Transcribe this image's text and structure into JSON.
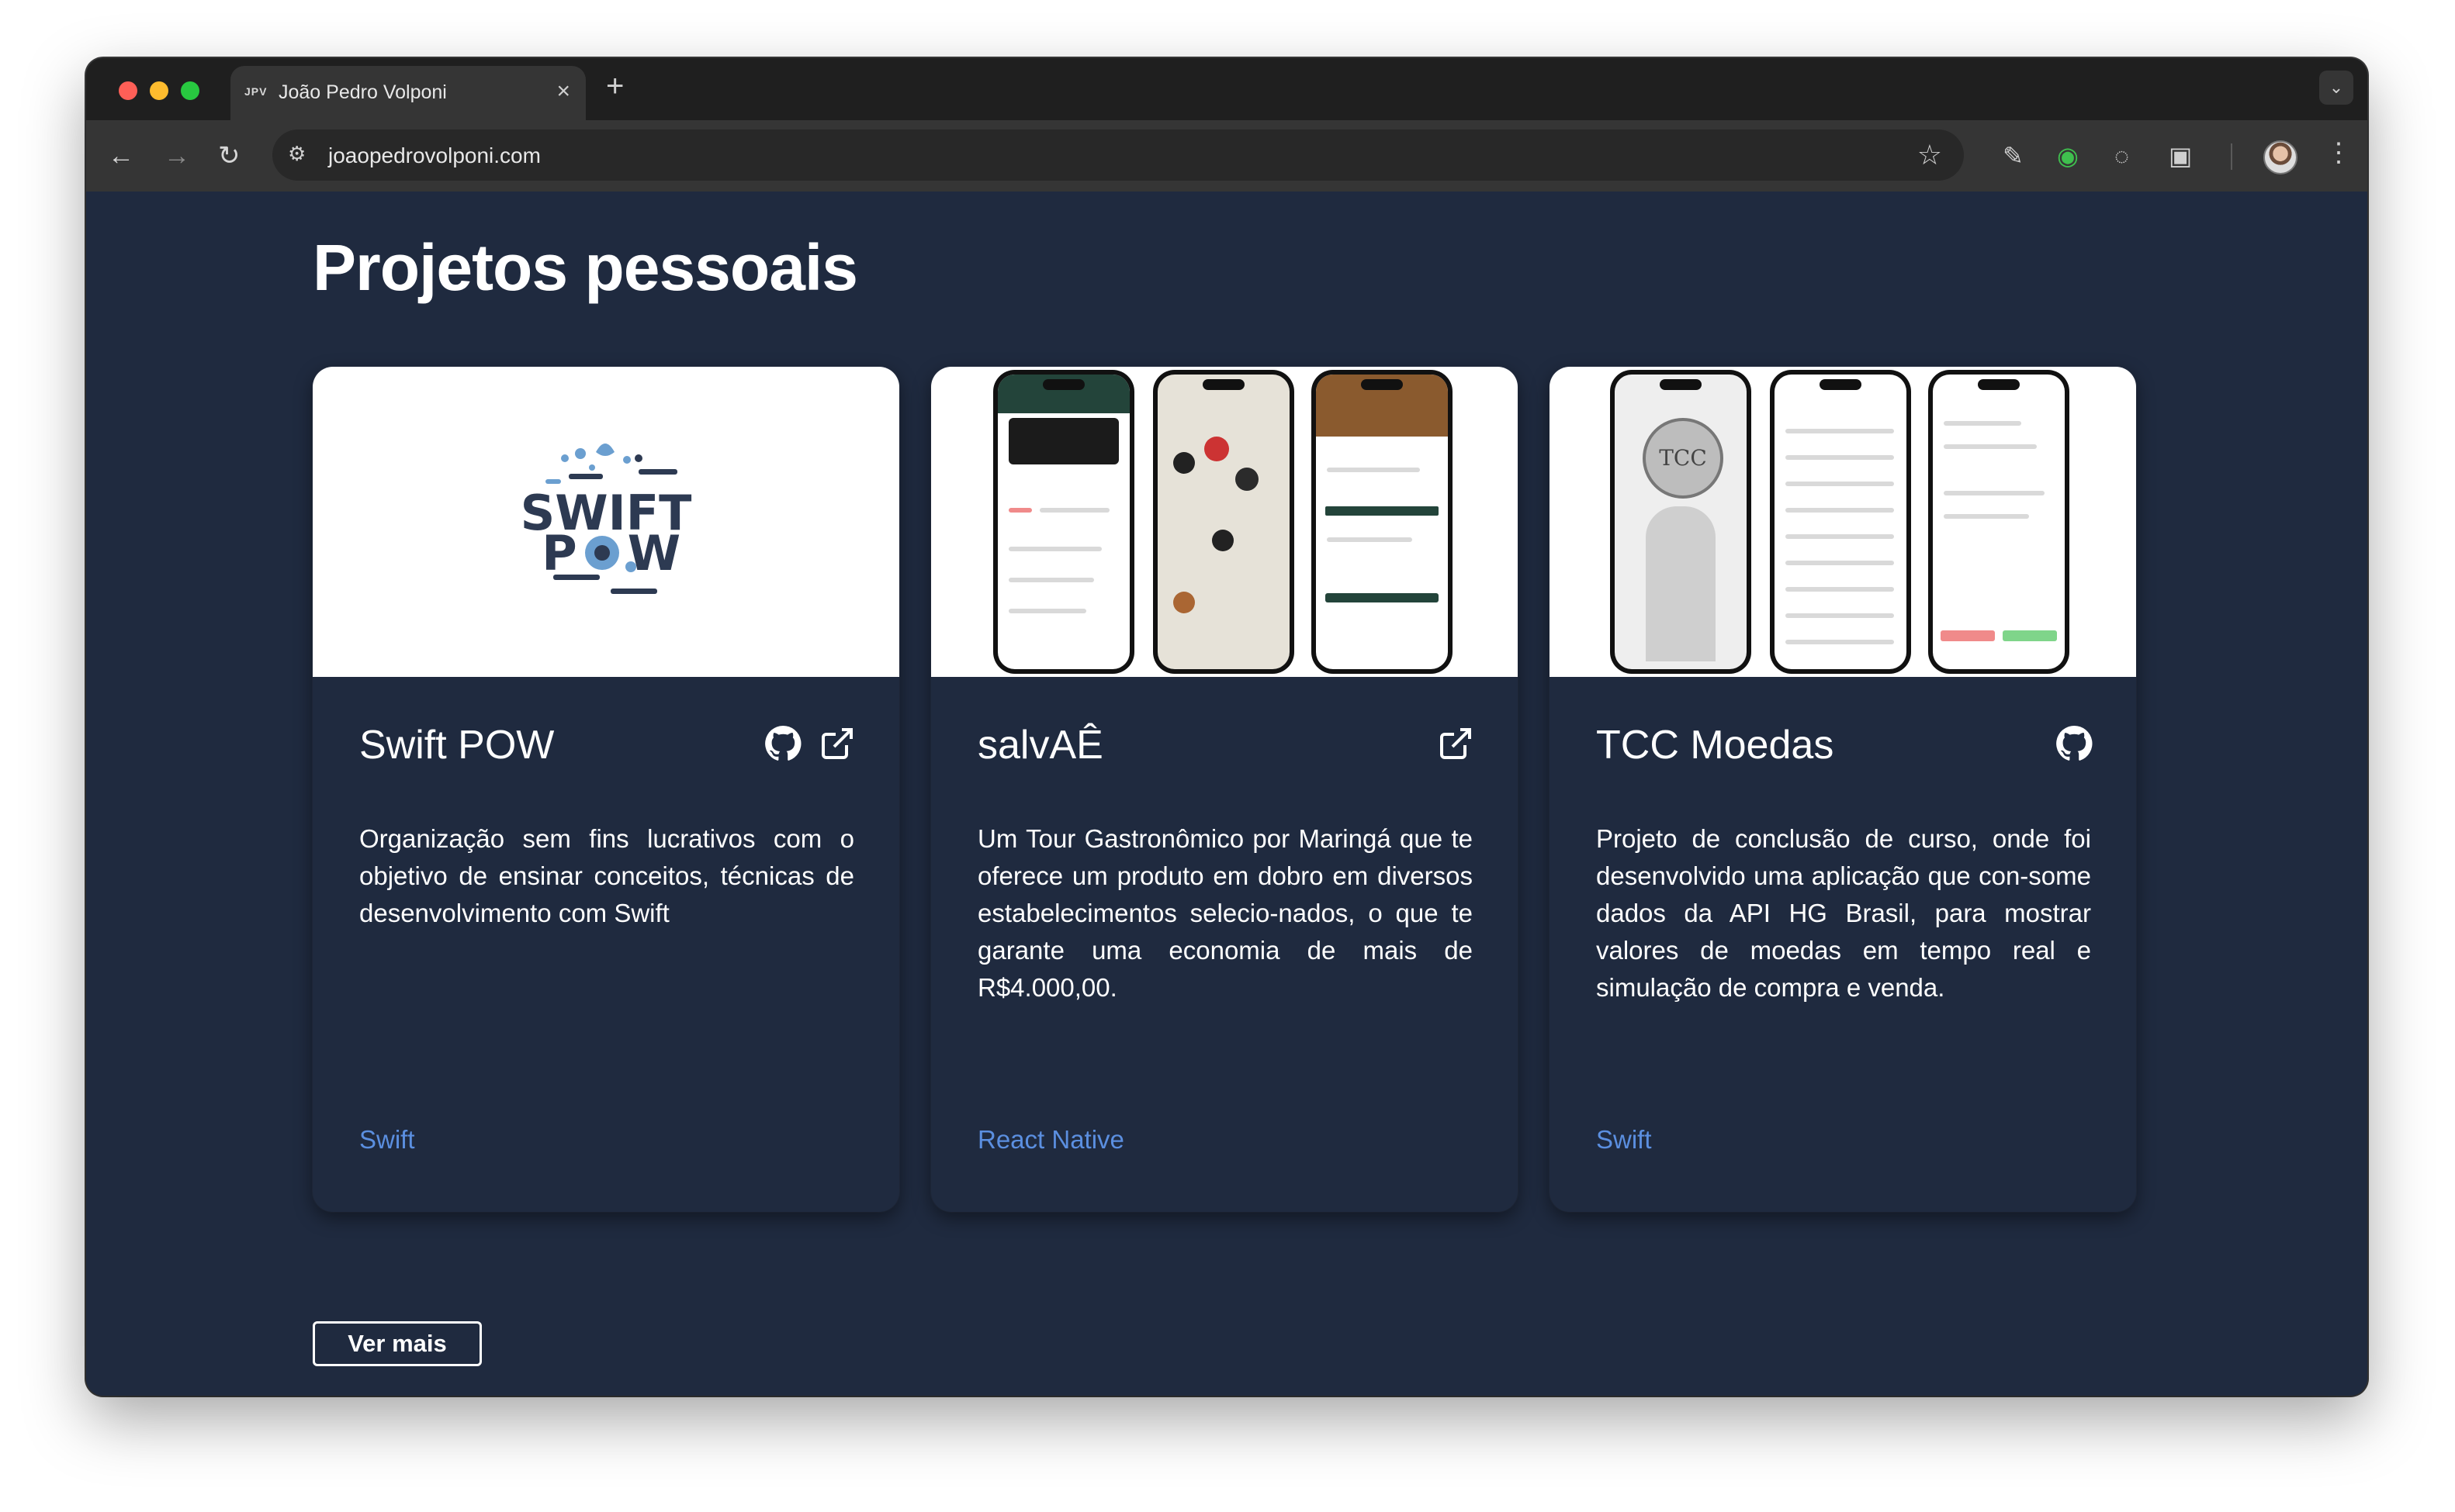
{
  "browser": {
    "tab_favicon": "JPV",
    "tab_title": "João Pedro Volponi",
    "tab_close": "×",
    "new_tab": "+",
    "url": "joaopedrovolponi.com",
    "icons": [
      "back-icon",
      "forward-icon",
      "reload-icon",
      "site-settings-icon",
      "bookmark-star-icon",
      "pen-extension-icon",
      "eye-extension-icon",
      "circle-extension-icon",
      "extensions-puzzle-icon",
      "profile-avatar",
      "more-menu-icon"
    ]
  },
  "page": {
    "heading": "Projetos pessoais",
    "see_more": "Ver mais"
  },
  "projects": [
    {
      "title": "Swift POW",
      "description": "Organização sem fins lucrativos com o objetivo de ensinar conceitos, técnicas de desenvolvimento com Swift",
      "tag": "Swift",
      "logo_line1": "SWIFT",
      "logo_line2": "P",
      "logo_line3": "W",
      "icons": [
        "github-icon",
        "external-link-icon"
      ]
    },
    {
      "title": "salvAÊ",
      "description": "Um Tour Gastronômico por Maringá que te oferece um produto em dobro em diversos estabelecimentos selecio-nados, o que te garante uma economia de mais de R$4.000,00.",
      "tag": "React Native",
      "icons": [
        "external-link-icon"
      ]
    },
    {
      "title": "TCC Moedas",
      "description": "Projeto de conclusão de curso, onde foi desenvolvido uma aplicação que con-some dados da API HG Brasil, para mostrar valores de moedas em tempo real e simulação de compra e venda.",
      "tag": "Swift",
      "coin_text": "TCC",
      "icons": [
        "github-icon"
      ]
    }
  ],
  "colors": {
    "page_background": "#1f2a3f",
    "tag_color": "#5b8fe0",
    "text": "#ffffff"
  }
}
